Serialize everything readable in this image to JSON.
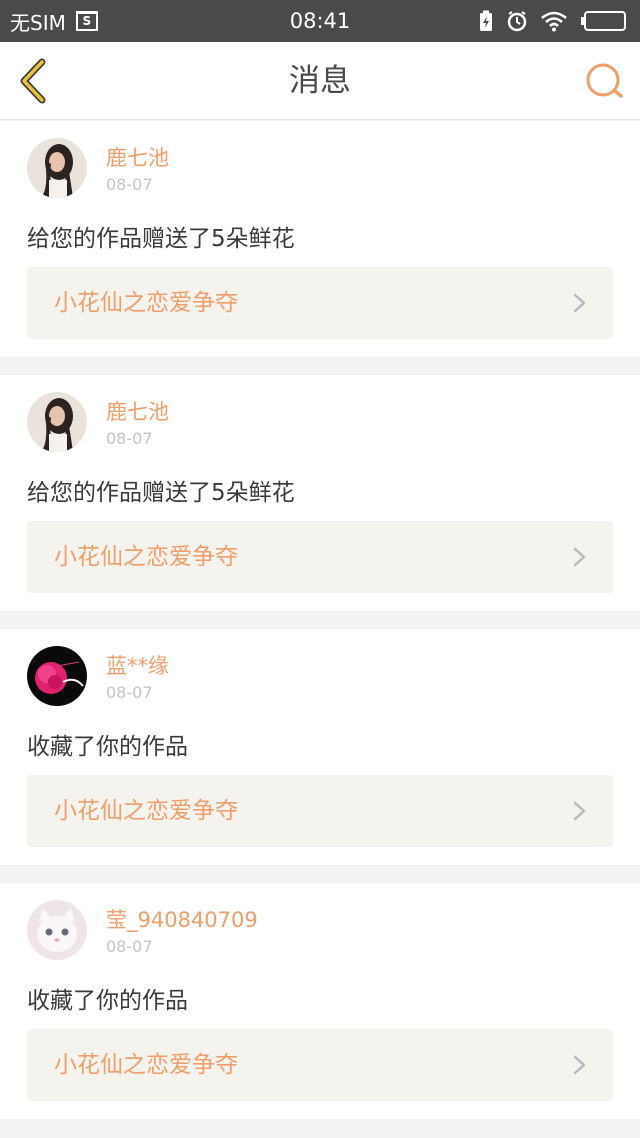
{
  "status_bar": {
    "carrier": "无SIM",
    "sim_badge": "S",
    "time": "08:41"
  },
  "header": {
    "title": "消息",
    "back_icon": "back-chevron-icon",
    "search_icon": "search-icon"
  },
  "colors": {
    "accent": "#ee9f6b",
    "back_arrow": "#e8c238",
    "statusbar": "#4a4a4a",
    "link_bg": "#f4f3ee"
  },
  "messages": [
    {
      "username": "鹿七池",
      "date": "08-07",
      "text": "给您的作品赠送了5朵鲜花",
      "work_title": "小花仙之恋爱争夺",
      "avatar": "girl-photo-avatar"
    },
    {
      "username": "鹿七池",
      "date": "08-07",
      "text": "给您的作品赠送了5朵鲜花",
      "work_title": "小花仙之恋爱争夺",
      "avatar": "girl-photo-avatar"
    },
    {
      "username": "蓝**缘",
      "date": "08-07",
      "text": "收藏了你的作品",
      "work_title": "小花仙之恋爱争夺",
      "avatar": "pink-flower-avatar"
    },
    {
      "username": "莹_940840709",
      "date": "08-07",
      "text": "收藏了你的作品",
      "work_title": "小花仙之恋爱争夺",
      "avatar": "white-cat-avatar"
    }
  ]
}
